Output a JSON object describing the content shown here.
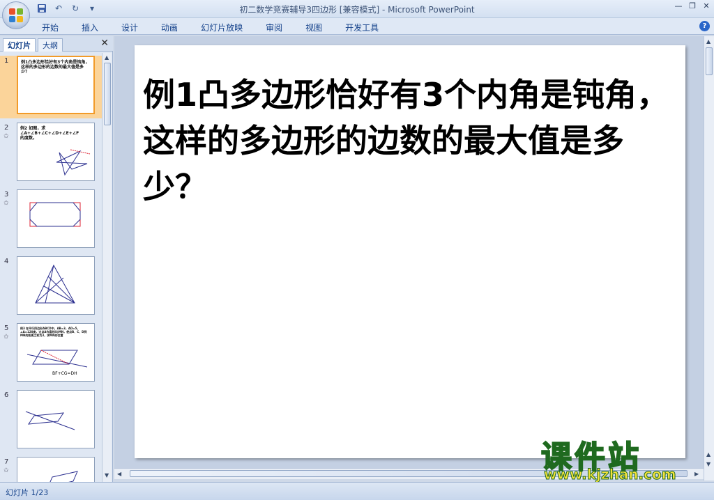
{
  "window": {
    "title": "初二数学竞赛辅导3四边形 [兼容模式] - Microsoft PowerPoint"
  },
  "ribbon": {
    "tabs": [
      "开始",
      "插入",
      "设计",
      "动画",
      "幻灯片放映",
      "审阅",
      "视图",
      "开发工具"
    ]
  },
  "pane": {
    "tab_slides": "幻灯片",
    "tab_outline": "大纲",
    "close": "✕"
  },
  "thumbnails": [
    {
      "num": "1",
      "text": "例1凸多边形恰好有3个内角是钝角，这样的多边形的边数的最大值是多少？"
    },
    {
      "num": "2",
      "text": "例2 如图，求 ∠A+∠B+∠C+∠D+∠E+∠F 的度数。"
    },
    {
      "num": "3",
      "text": ""
    },
    {
      "num": "4",
      "text": ""
    },
    {
      "num": "5",
      "text": "例3 在平行四边形ABCD中，AB=3，AD=5，∠A=120度，过点A作直线l与MN，使点B、C、D到MN的距离之和为3，求MN的位置",
      "extra": "BF+CG=DH"
    },
    {
      "num": "6",
      "text": ""
    },
    {
      "num": "7",
      "text": ""
    }
  ],
  "slide": {
    "title": "例1凸多边形恰好有3个内角是钝角，这样的多边形的边数的最大值是多少？"
  },
  "watermark": {
    "brand": "课件站",
    "url": "www.kjzhan.com"
  },
  "status": {
    "slide_counter": "幻灯片 1/23"
  }
}
